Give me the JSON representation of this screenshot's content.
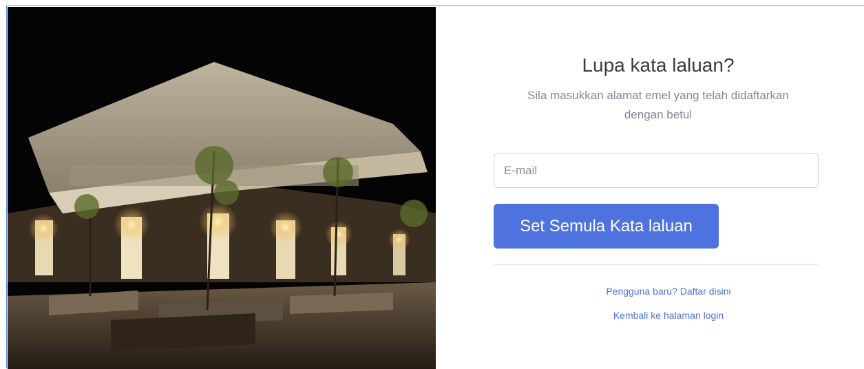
{
  "photo": {
    "icon": "building-night-photo"
  },
  "form": {
    "title": "Lupa kata laluan?",
    "subtitle": "Sila masukkan alamat emel yang telah didaftarkan dengan betul",
    "email": {
      "value": "",
      "placeholder": "E-mail"
    },
    "reset_button_label": "Set Semula Kata laluan",
    "register_link": "Pengguna baru? Daftar disini",
    "login_link": "Kembali ke halaman login"
  },
  "colors": {
    "accent": "#4e73df",
    "frame_border": "#5b8fd9",
    "title_text": "#3a3b45",
    "muted_text": "#858796"
  }
}
